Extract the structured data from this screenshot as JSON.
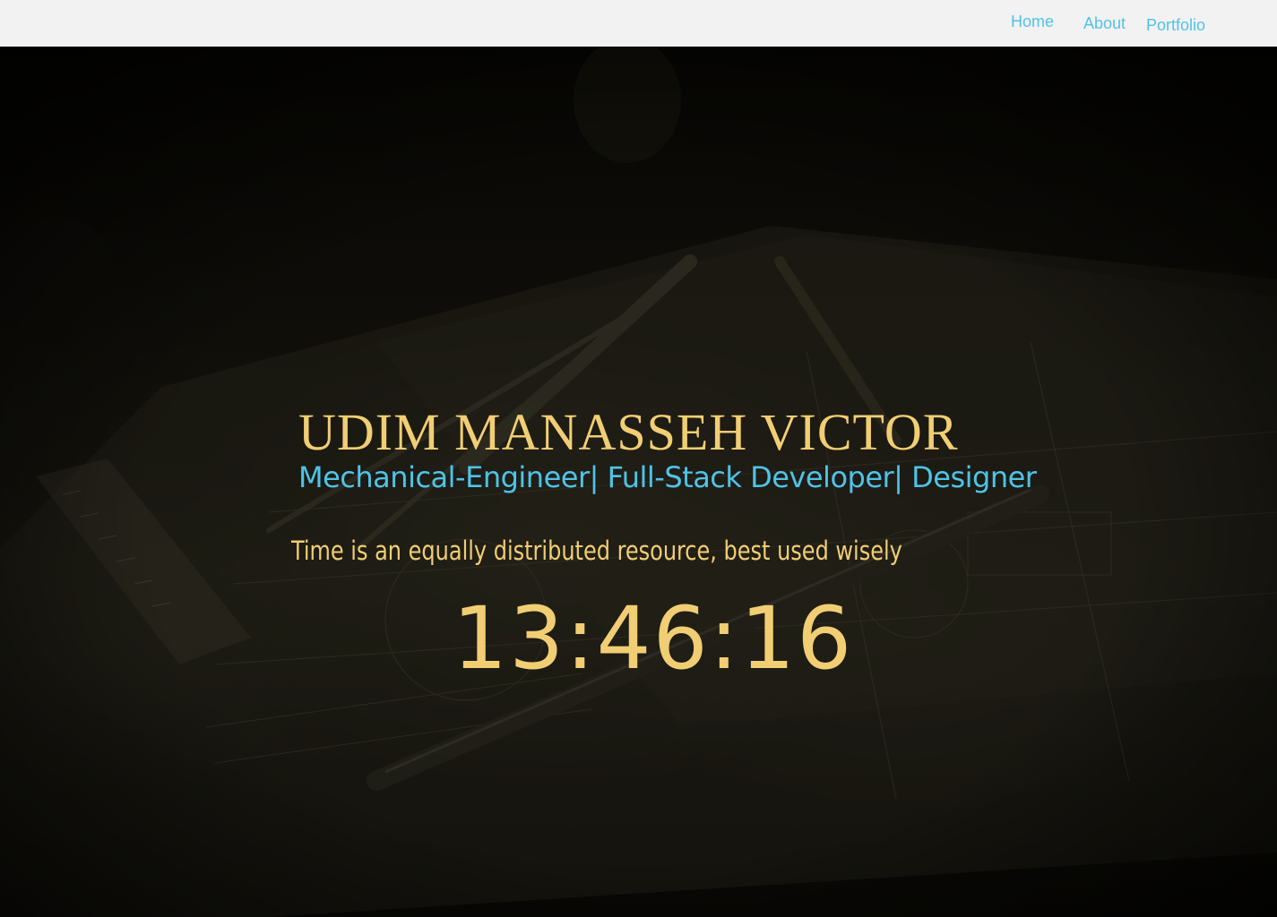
{
  "nav": {
    "links": [
      "Home",
      "About",
      "Portfolio"
    ]
  },
  "hero": {
    "name": "UDIM MANASSEH VICTOR",
    "roles": "Mechanical-Engineer| Full-Stack Developer| Designer",
    "quote": "Time is an equally distributed resource, best used wisely",
    "clock": "13:46:16"
  },
  "colors": {
    "navbar_bg": "#f2f2f2",
    "link": "#4fc3e8",
    "accent_gold": "#f1ce74",
    "hero_bg": "#0b0a06"
  }
}
